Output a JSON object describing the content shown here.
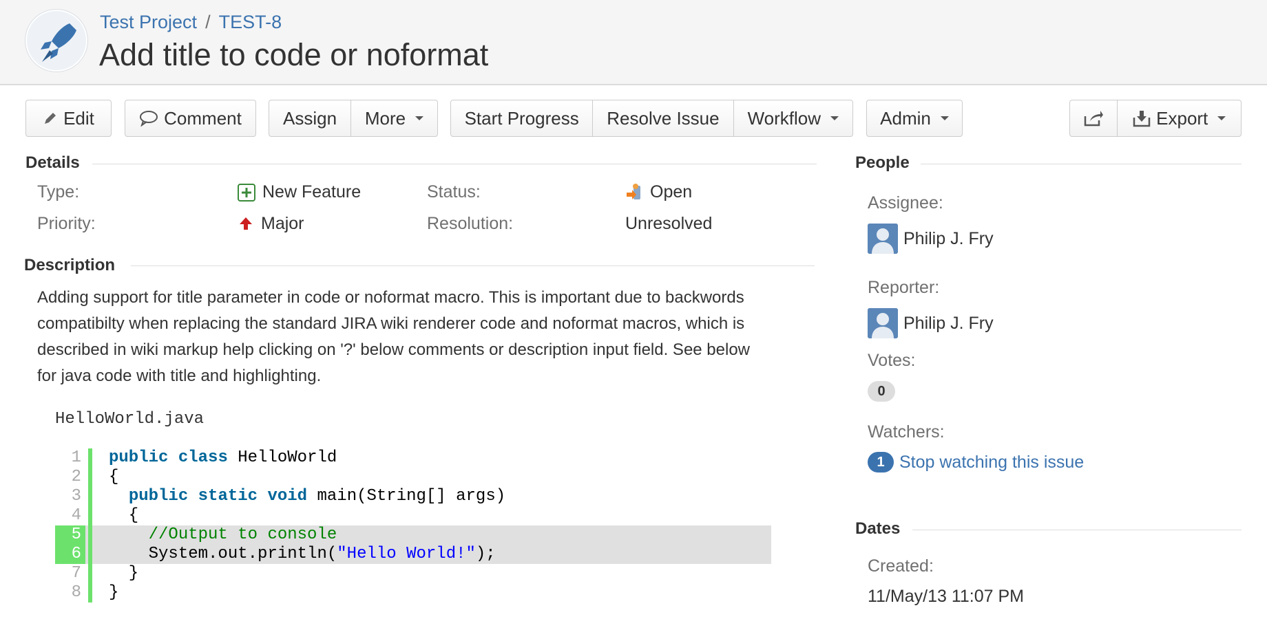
{
  "breadcrumb": {
    "project": "Test Project",
    "separator": "/",
    "issue_key": "TEST-8"
  },
  "issue": {
    "title": "Add title to code or noformat"
  },
  "toolbar": {
    "edit": "Edit",
    "comment": "Comment",
    "assign": "Assign",
    "more": "More",
    "start_progress": "Start Progress",
    "resolve_issue": "Resolve Issue",
    "workflow": "Workflow",
    "admin": "Admin",
    "export": "Export"
  },
  "details": {
    "heading": "Details",
    "type_label": "Type:",
    "type_value": "New Feature",
    "status_label": "Status:",
    "status_value": "Open",
    "priority_label": "Priority:",
    "priority_value": "Major",
    "resolution_label": "Resolution:",
    "resolution_value": "Unresolved"
  },
  "description": {
    "heading": "Description",
    "text": "Adding support for title parameter in code or noformat macro. This is important due to backwords compatibilty when replacing the standard JIRA wiki renderer code and noformat macros, which is described in wiki markup help clicking on '?' below comments or description input field. See below for java code with title and highlighting.",
    "code_title": "HelloWorld.java",
    "code_lines": [
      {
        "n": "1",
        "text": "public class HelloWorld"
      },
      {
        "n": "2",
        "text": "{"
      },
      {
        "n": "3",
        "text": "  public static void main(String[] args)"
      },
      {
        "n": "4",
        "text": "  {"
      },
      {
        "n": "5",
        "text": "    //Output to console"
      },
      {
        "n": "6",
        "text": "    System.out.println(\"Hello World!\");"
      },
      {
        "n": "7",
        "text": "  }"
      },
      {
        "n": "8",
        "text": "}"
      }
    ]
  },
  "people": {
    "heading": "People",
    "assignee_label": "Assignee:",
    "assignee": "Philip J. Fry",
    "reporter_label": "Reporter:",
    "reporter": "Philip J. Fry",
    "votes_label": "Votes:",
    "votes": "0",
    "watchers_label": "Watchers:",
    "watchers_count": "1",
    "watch_link": "Stop watching this issue"
  },
  "dates": {
    "heading": "Dates",
    "created_label": "Created:",
    "created": "11/May/13 11:07 PM"
  },
  "colors": {
    "link": "#3b73af",
    "highlight_green": "#6ce26c",
    "header_bg": "#f5f5f5"
  }
}
